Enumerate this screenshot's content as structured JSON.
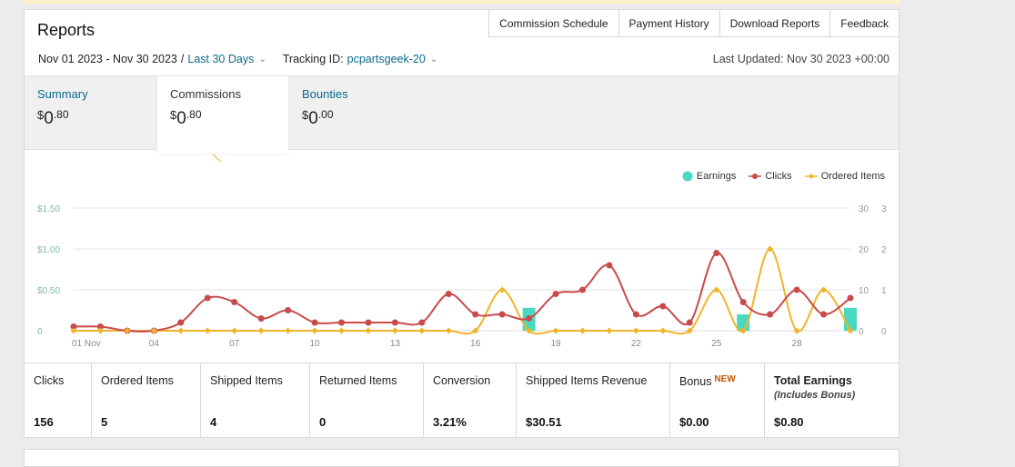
{
  "header": {
    "title": "Reports"
  },
  "topnav": [
    "Commission Schedule",
    "Payment History",
    "Download Reports",
    "Feedback"
  ],
  "filters": {
    "date_range": "Nov 01 2023 - Nov 30 2023",
    "separator": "/",
    "period": "Last 30 Days",
    "tracking_label": "Tracking ID:",
    "tracking_id": "pcpartsgeek-20",
    "last_updated": "Last Updated: Nov 30 2023 +00:00"
  },
  "tabs": [
    {
      "label": "Summary",
      "currency": "$",
      "whole": "0",
      "cents": ".80",
      "active": false,
      "link": true
    },
    {
      "label": "Commissions",
      "currency": "$",
      "whole": "0",
      "cents": ".80",
      "active": true,
      "link": false
    },
    {
      "label": "Bounties",
      "currency": "$",
      "whole": "0",
      "cents": ".00",
      "active": false,
      "link": true
    }
  ],
  "legend": {
    "earnings": "Earnings",
    "clicks": "Clicks",
    "ordered": "Ordered Items"
  },
  "colors": {
    "earnings": "#48d9c0",
    "clicks": "#c94a4a",
    "ordered": "#f0b429",
    "link": "#0a6a8c",
    "new_badge": "#c45500"
  },
  "chart_data": {
    "type": "line",
    "x_ticks": [
      "01 Nov",
      "04",
      "07",
      "10",
      "13",
      "16",
      "19",
      "22",
      "25",
      "28"
    ],
    "y_left_ticks": [
      "$1.50",
      "$1.00",
      "$0.50",
      "0"
    ],
    "y_right_ticks_clicks": [
      "30",
      "20",
      "10",
      "0"
    ],
    "y_right_ticks_items": [
      "3",
      "2",
      "1",
      "0"
    ],
    "days": [
      1,
      2,
      3,
      4,
      5,
      6,
      7,
      8,
      9,
      10,
      11,
      12,
      13,
      14,
      15,
      16,
      17,
      18,
      19,
      20,
      21,
      22,
      23,
      24,
      25,
      26,
      27,
      28,
      29,
      30
    ],
    "series": [
      {
        "name": "Earnings",
        "axis": "dollars",
        "ylim": [
          0,
          1.5
        ],
        "values": [
          0,
          0,
          0,
          0,
          0,
          0,
          0,
          0,
          0,
          0,
          0,
          0,
          0,
          0,
          0,
          0,
          0,
          0.28,
          0,
          0,
          0,
          0,
          0,
          0,
          0,
          0.2,
          0,
          0,
          0,
          0.28
        ]
      },
      {
        "name": "Clicks",
        "axis": "clicks",
        "ylim": [
          0,
          30
        ],
        "values": [
          1,
          1,
          0,
          0,
          2,
          8,
          7,
          3,
          5,
          2,
          2,
          2,
          2,
          2,
          9,
          4,
          4,
          3,
          9,
          10,
          16,
          4,
          6,
          2,
          19,
          7,
          4,
          10,
          4,
          8
        ]
      },
      {
        "name": "Ordered Items",
        "axis": "items",
        "ylim": [
          0,
          3
        ],
        "values": [
          0,
          0,
          0,
          0,
          0,
          0,
          0,
          0,
          0,
          0,
          0,
          0,
          0,
          0,
          0,
          0,
          1,
          0,
          0,
          0,
          0,
          0,
          0,
          0,
          1,
          0,
          2,
          0,
          1,
          0
        ]
      }
    ]
  },
  "stats": [
    {
      "label": "Clicks",
      "value": "156"
    },
    {
      "label": "Ordered Items",
      "value": "5"
    },
    {
      "label": "Shipped Items",
      "value": "4"
    },
    {
      "label": "Returned Items",
      "value": "0"
    },
    {
      "label": "Conversion",
      "value": "3.21%"
    },
    {
      "label": "Shipped Items Revenue",
      "value": "$30.51"
    },
    {
      "label": "Bonus",
      "badge": "NEW",
      "value": "$0.00"
    },
    {
      "label": "Total Earnings",
      "sublabel": "(Includes Bonus)",
      "value": "$0.80"
    }
  ]
}
